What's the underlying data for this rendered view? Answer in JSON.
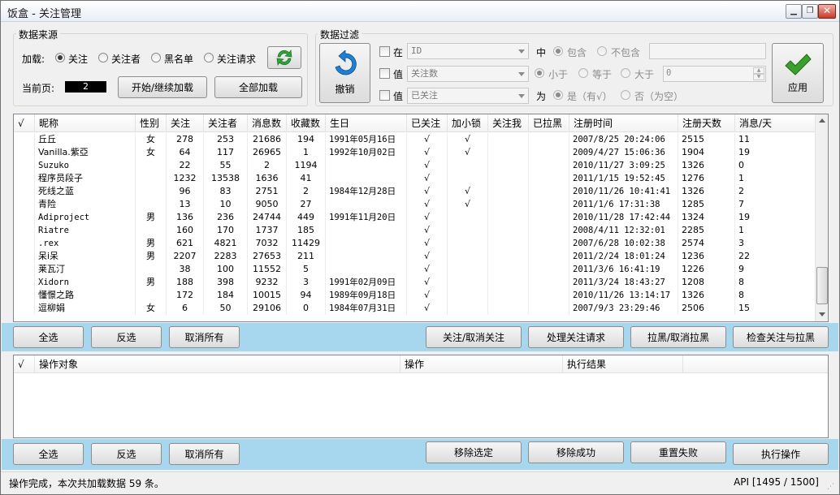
{
  "window": {
    "title": "饭盒 - 关注管理"
  },
  "source": {
    "group_title": "数据来源",
    "load_label": "加载:",
    "options": [
      "关注",
      "关注者",
      "黑名单",
      "关注请求"
    ],
    "selected": "关注",
    "current_page_label": "当前页:",
    "current_page_value": "2",
    "start_button": "开始/继续加载",
    "load_all_button": "全部加载"
  },
  "filter": {
    "group_title": "数据过滤",
    "undo_button": "撤销",
    "apply_button": "应用",
    "row1": {
      "label": "在",
      "field": "ID",
      "in_label": "中",
      "opt_include": "包含",
      "opt_exclude": "不包含",
      "value": ""
    },
    "row2": {
      "label": "值",
      "field": "关注数",
      "opt_lt": "小于",
      "opt_eq": "等于",
      "opt_gt": "大于",
      "number": "0"
    },
    "row3": {
      "label": "值",
      "field": "已关注",
      "is_label": "为",
      "opt_yes": "是（有√）",
      "opt_no": "否（为空）"
    }
  },
  "user_table": {
    "columns": [
      "√",
      "昵称",
      "性别",
      "关注",
      "关注者",
      "消息数",
      "收藏数",
      "生日",
      "已关注",
      "加小锁",
      "关注我",
      "已拉黑",
      "注册时间",
      "注册天数",
      "消息/天"
    ],
    "rows": [
      [
        "",
        "丘丘",
        "女",
        "278",
        "253",
        "21686",
        "194",
        "1991年05月16日",
        "√",
        "√",
        "",
        "",
        "2007/8/25 20:24:06",
        "2515",
        "11"
      ],
      [
        "",
        "Vanilla.紫亞",
        "女",
        "64",
        "117",
        "26965",
        "1",
        "1992年10月02日",
        "√",
        "√",
        "",
        "",
        "2009/4/27 15:06:36",
        "1904",
        "19"
      ],
      [
        "",
        "Suzuko",
        "",
        "22",
        "55",
        "2",
        "1194",
        "",
        "√",
        "",
        "",
        "",
        "2010/11/27 3:09:25",
        "1326",
        "0"
      ],
      [
        "",
        "程序员段子",
        "",
        "1232",
        "13538",
        "1636",
        "41",
        "",
        "√",
        "",
        "",
        "",
        "2011/1/15 19:52:45",
        "1276",
        "1"
      ],
      [
        "",
        "死线之蓝",
        "",
        "96",
        "83",
        "2751",
        "2",
        "1984年12月28日",
        "√",
        "√",
        "",
        "",
        "2010/11/26 10:41:41",
        "1326",
        "2"
      ],
      [
        "",
        "青险",
        "",
        "13",
        "10",
        "9050",
        "27",
        "",
        "√",
        "√",
        "",
        "",
        "2011/1/6 17:31:38",
        "1285",
        "7"
      ],
      [
        "",
        "Adiproject",
        "男",
        "136",
        "236",
        "24744",
        "449",
        "1991年11月20日",
        "√",
        "",
        "",
        "",
        "2010/11/28 17:42:44",
        "1324",
        "19"
      ],
      [
        "",
        "Riatre",
        "",
        "160",
        "170",
        "1737",
        "185",
        "",
        "√",
        "",
        "",
        "",
        "2008/4/11 12:32:01",
        "2285",
        "1"
      ],
      [
        "",
        ".rex",
        "男",
        "621",
        "4821",
        "7032",
        "11429",
        "",
        "√",
        "",
        "",
        "",
        "2007/6/28 10:02:38",
        "2574",
        "3"
      ],
      [
        "",
        "呆i呆",
        "男",
        "2207",
        "2283",
        "27653",
        "211",
        "",
        "√",
        "",
        "",
        "",
        "2011/2/24 18:01:24",
        "1236",
        "22"
      ],
      [
        "",
        "莱瓦汀",
        "",
        "38",
        "100",
        "11552",
        "5",
        "",
        "√",
        "",
        "",
        "",
        "2011/3/6 16:41:19",
        "1226",
        "9"
      ],
      [
        "",
        "Xidorn",
        "男",
        "188",
        "398",
        "9232",
        "3",
        "1991年02月09日",
        "√",
        "",
        "",
        "",
        "2011/3/24 18:43:27",
        "1208",
        "8"
      ],
      [
        "",
        "懂憬之路",
        "",
        "172",
        "184",
        "10015",
        "94",
        "1989年09月18日",
        "√",
        "",
        "",
        "",
        "2010/11/26 13:14:17",
        "1326",
        "8"
      ],
      [
        "",
        "逗柳娟",
        "女",
        "6",
        "50",
        "29106",
        "0",
        "1984年07月31日",
        "√",
        "",
        "",
        "",
        "2007/9/3 23:29:46",
        "2506",
        "15"
      ]
    ]
  },
  "table_buttons": {
    "select_all": "全选",
    "invert": "反选",
    "cancel_all": "取消所有",
    "follow_toggle": "关注/取消关注",
    "process_requests": "处理关注请求",
    "block_toggle": "拉黑/取消拉黑",
    "check_follow_block": "检查关注与拉黑"
  },
  "ops_table": {
    "columns": [
      "√",
      "操作对象",
      "操作",
      "执行结果"
    ],
    "rows": []
  },
  "ops_buttons": {
    "select_all": "全选",
    "invert": "反选",
    "cancel_all": "取消所有",
    "remove_selected": "移除选定",
    "remove_success": "移除成功",
    "reset_failed": "重置失败",
    "execute": "执行操作"
  },
  "status": {
    "message": "操作完成，本次共加载数据 59 条。",
    "api": "API [1495 / 1500]"
  },
  "colors": {
    "accent_bar": "#a7d7ef",
    "apply_icon": "#3aa02c",
    "undo_icon": "#1e7fd3",
    "refresh_icon": "#2fa43a"
  }
}
